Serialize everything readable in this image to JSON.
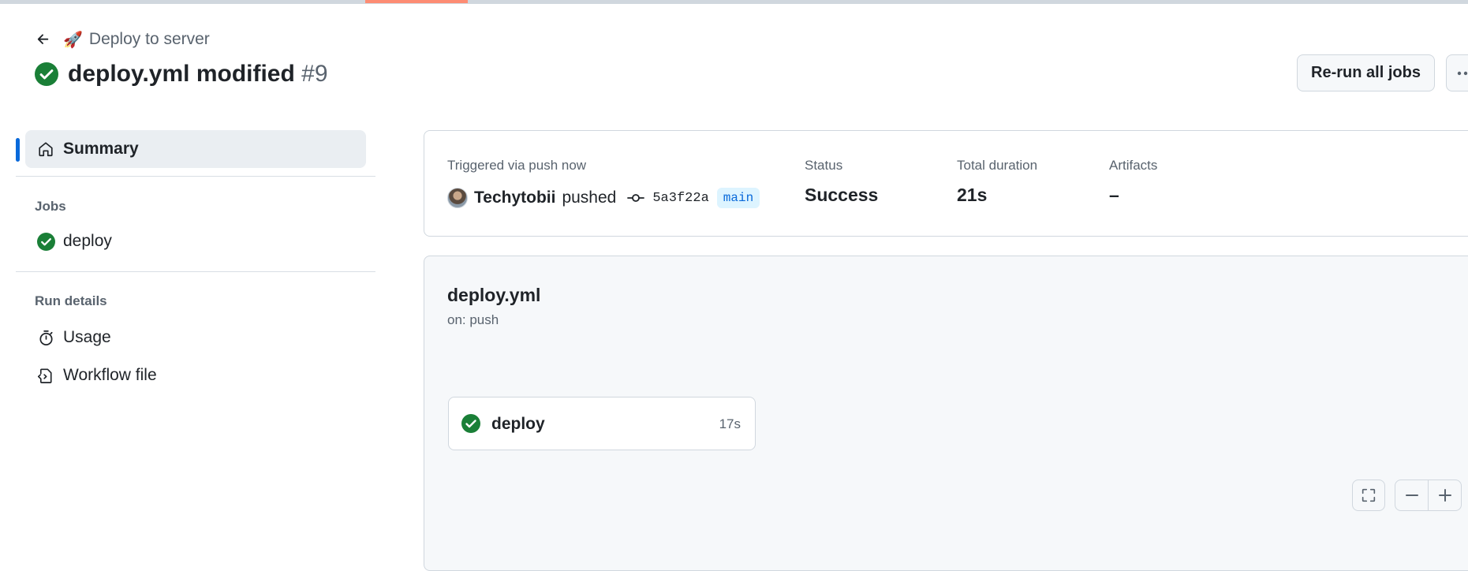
{
  "header": {
    "workflow_name": "Deploy to server",
    "run_title": "deploy.yml modified",
    "run_number": "#9",
    "rerun_label": "Re-run all jobs"
  },
  "sidebar": {
    "summary_label": "Summary",
    "jobs_heading": "Jobs",
    "jobs": [
      {
        "label": "deploy",
        "status": "success"
      }
    ],
    "run_details_heading": "Run details",
    "usage_label": "Usage",
    "workflow_file_label": "Workflow file"
  },
  "summary": {
    "trigger_label": "Triggered via push now",
    "actor": "Techytobii",
    "action": "pushed",
    "commit_sha": "5a3f22a",
    "branch": "main",
    "status_label": "Status",
    "status_value": "Success",
    "duration_label": "Total duration",
    "duration_value": "21s",
    "artifacts_label": "Artifacts",
    "artifacts_value": "–"
  },
  "graph": {
    "workflow_file": "deploy.yml",
    "trigger": "on: push",
    "job": {
      "name": "deploy",
      "duration": "17s",
      "status": "success"
    }
  },
  "icons": {
    "success": "check-circle-fill",
    "back": "arrow-left",
    "summary": "home",
    "usage": "stopwatch",
    "workflow_file": "file-code",
    "commit": "git-commit",
    "fullscreen": "screen-full",
    "zoom_out": "dash",
    "zoom_in": "plus"
  },
  "colors": {
    "success": "#1a7f37",
    "accent": "#0969da",
    "progress": "#fd8c73",
    "branch_bg": "#ddf4ff"
  }
}
